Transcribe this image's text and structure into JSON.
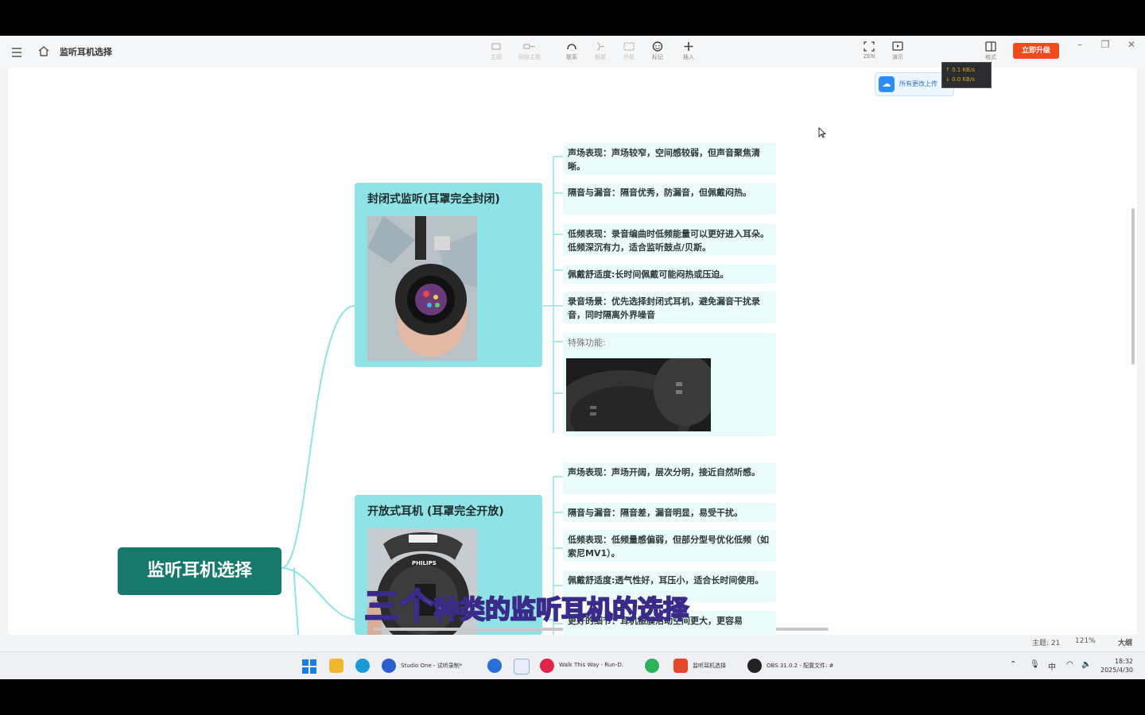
{
  "app": {
    "doc_title": "监听耳机选择",
    "toolbar": [
      {
        "label": "主题",
        "icon": "topic-icon",
        "dim": true
      },
      {
        "label": "同级主题",
        "icon": "sibling-topic-icon",
        "dim": true
      },
      {
        "label": "联系",
        "icon": "relation-icon",
        "dim": false
      },
      {
        "label": "概要",
        "icon": "summary-icon",
        "dim": true
      },
      {
        "label": "外框",
        "icon": "boundary-icon",
        "dim": true
      },
      {
        "label": "标记",
        "icon": "marker-icon",
        "dim": false
      },
      {
        "label": "插入",
        "icon": "insert-icon",
        "dim": false
      }
    ],
    "right_tools": [
      {
        "label": "ZEN",
        "icon": "zen-icon"
      },
      {
        "label": "演示",
        "icon": "present-icon"
      },
      {
        "label": "格式",
        "icon": "format-icon"
      }
    ],
    "upgrade_label": "立即升级",
    "cloud_label": "所有更改上传",
    "net_up": "↑ 0.1 KB/s",
    "net_down": "↓ 0.0 KB/s"
  },
  "mindmap": {
    "root": "监听耳机选择",
    "closed": {
      "title": "封闭式监听(耳罩完全封闭)",
      "items": [
        "声场表现：声场较窄，空间感较弱，但声音聚焦清晰。",
        "隔音与漏音：隔音优秀，防漏音，但佩戴闷热。",
        "低频表现：录音编曲时低频能量可以更好进入耳朵。低频深沉有力，适合监听鼓点/贝斯。",
        "佩戴舒适度:长时间佩戴可能闷热或压迫。",
        "录音场景：优先选择封闭式耳机，避免漏音干扰录音，同时隔离外界噪音"
      ],
      "special_label": "特殊功能:"
    },
    "open": {
      "title": "开放式耳机 (耳罩完全开放)",
      "photo_brand": "PHILIPS",
      "items": [
        "声场表现：声场开阔，层次分明，接近自然听感。",
        "隔音与漏音：隔音差，漏音明显，易受干扰。",
        "低频表现：低频量感偏弱，但部分型号优化低频（如索尼MV1）。",
        "佩戴舒适度:透气性好，耳压小，适合长时间使用。",
        "更好的细节：耳机振膜活动空间更大，更容易"
      ]
    }
  },
  "status": {
    "topics": "主题: 21",
    "zoom": "121%",
    "outline": "大纲"
  },
  "subtitle": {
    "big": "三个",
    "rest": "种类的监听耳机的选择"
  },
  "taskbar": {
    "items": [
      "Studio One - 试听录制*",
      "Walk This Way - Run-D.",
      "监听耳机选择",
      "OBS 31.0.2 - 配置文件: #"
    ],
    "ime": "中",
    "time": "18:32",
    "date": "2025/4/30"
  },
  "colors": {
    "root": "#16796c",
    "branch": "#8fe3e6",
    "leaf": "#e9fbfb",
    "connector": "#8fe3e6",
    "upgrade": "#f04a1e"
  }
}
